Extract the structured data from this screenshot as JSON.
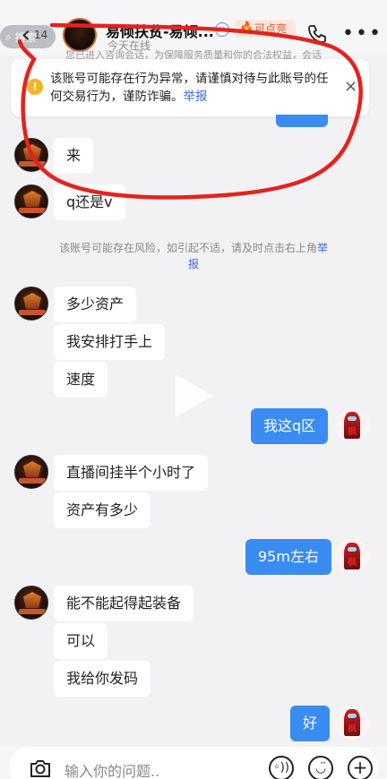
{
  "header": {
    "search_label": "搜索",
    "unread_count": "14",
    "contact_name": "易倾扶贫-易倾...",
    "verified_glyph": "v",
    "badge_label": "可点亮",
    "online_status": "今天在线",
    "notice_partial": "您已进入咨询会话，为保障服务质量和你的合法权益，会话"
  },
  "warning": {
    "text": "该账号可能存在行为异常，请谨慎对待与此账号的任何交易行为，谨防诈骗。",
    "report_link": "举报",
    "icon_glyph": "!",
    "close_glyph": "×"
  },
  "messages": {
    "m1": "来",
    "m2": "q还是v",
    "m3": "多少资产",
    "m4": "我安排打手上",
    "m5": "速度",
    "m6": "我这q区",
    "m7": "直播间挂半个小时了",
    "m8": "资产有多少",
    "m9": "95m左右",
    "m10": "能不能起得起装备",
    "m11": "可以",
    "m12": "我给你发码",
    "m13": "好"
  },
  "system_notice": {
    "text": "该账号可能存在风险，如引起不适，请及时点击右上角",
    "report_link": "举报"
  },
  "input": {
    "placeholder": "输入你的问题.."
  },
  "colors": {
    "outgoing_bubble": "#3a8cf2",
    "link": "#3b6ad9",
    "annotation": "#e5221c"
  }
}
